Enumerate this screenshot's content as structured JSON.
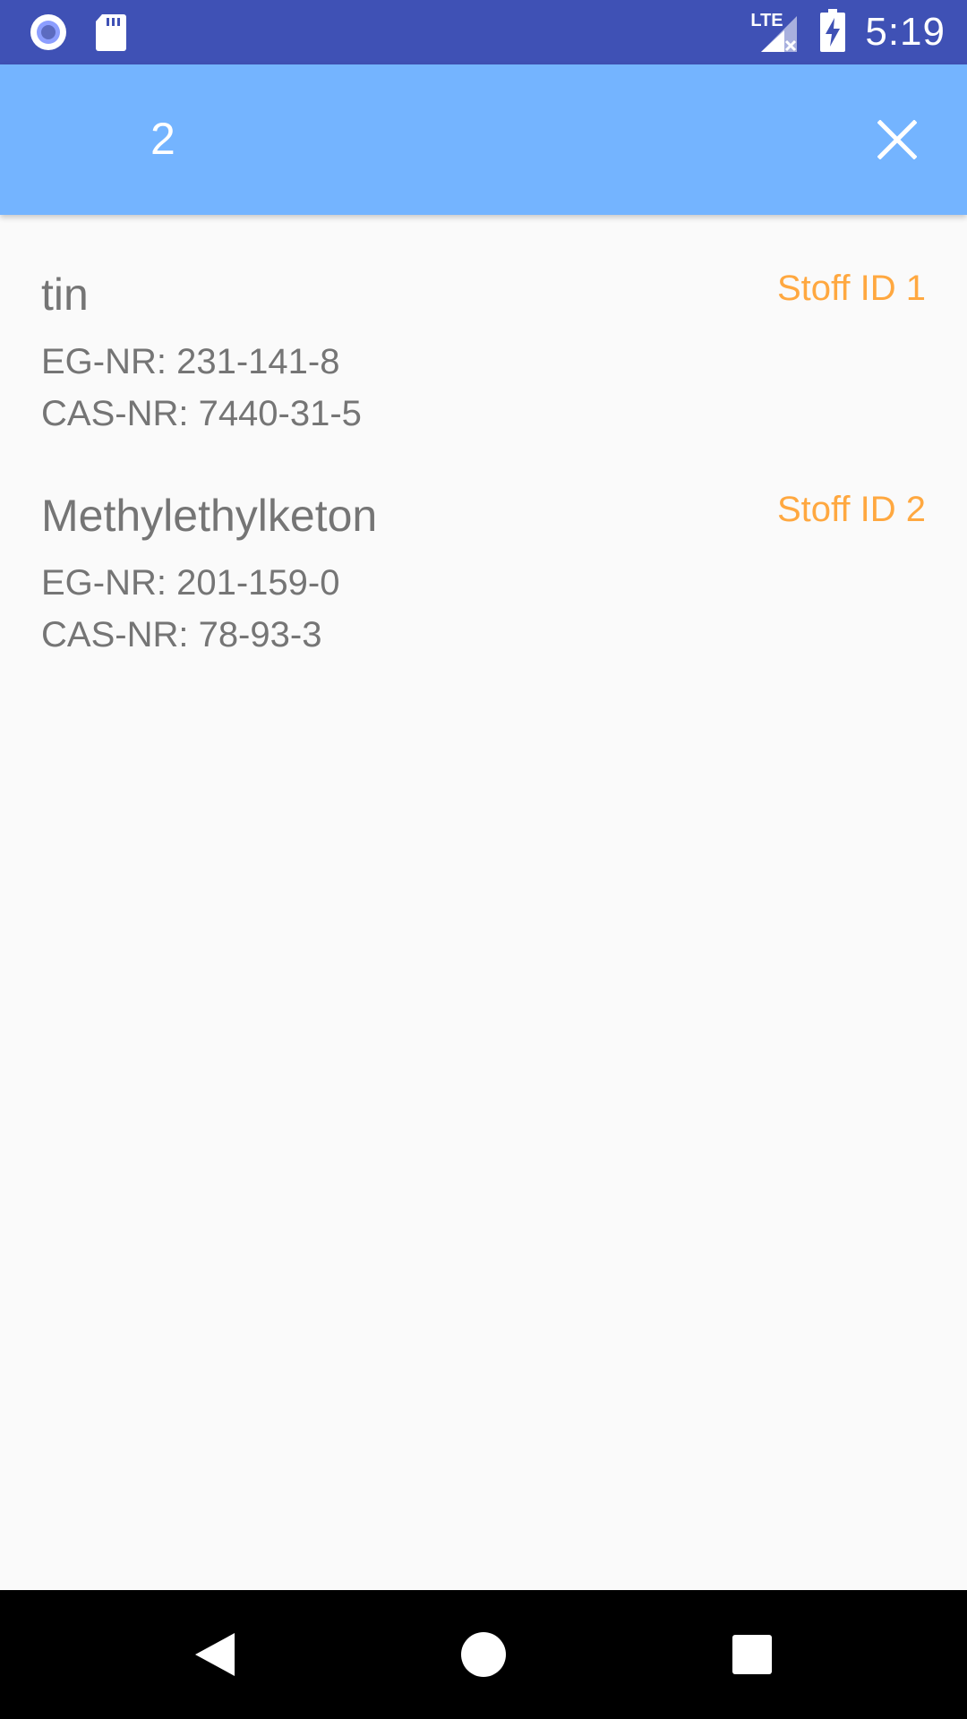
{
  "status_bar": {
    "time": "5:19",
    "network_label": "LTE",
    "icons": [
      "record-icon",
      "sd-card-icon",
      "signal-icon",
      "battery-charging-icon"
    ]
  },
  "search": {
    "query": "2"
  },
  "results": [
    {
      "name": "tin",
      "eg_nr": "EG-NR: 231-141-8",
      "cas_nr": "CAS-NR: 7440-31-5",
      "id_label": "Stoff ID 1"
    },
    {
      "name": "Methylethylketon",
      "eg_nr": "EG-NR: 201-159-0",
      "cas_nr": "CAS-NR: 78-93-3",
      "id_label": "Stoff ID 2"
    }
  ],
  "colors": {
    "status_bar": "#3f51b5",
    "app_bar": "#74b4ff",
    "accent": "#ffa840",
    "text": "#757575"
  }
}
